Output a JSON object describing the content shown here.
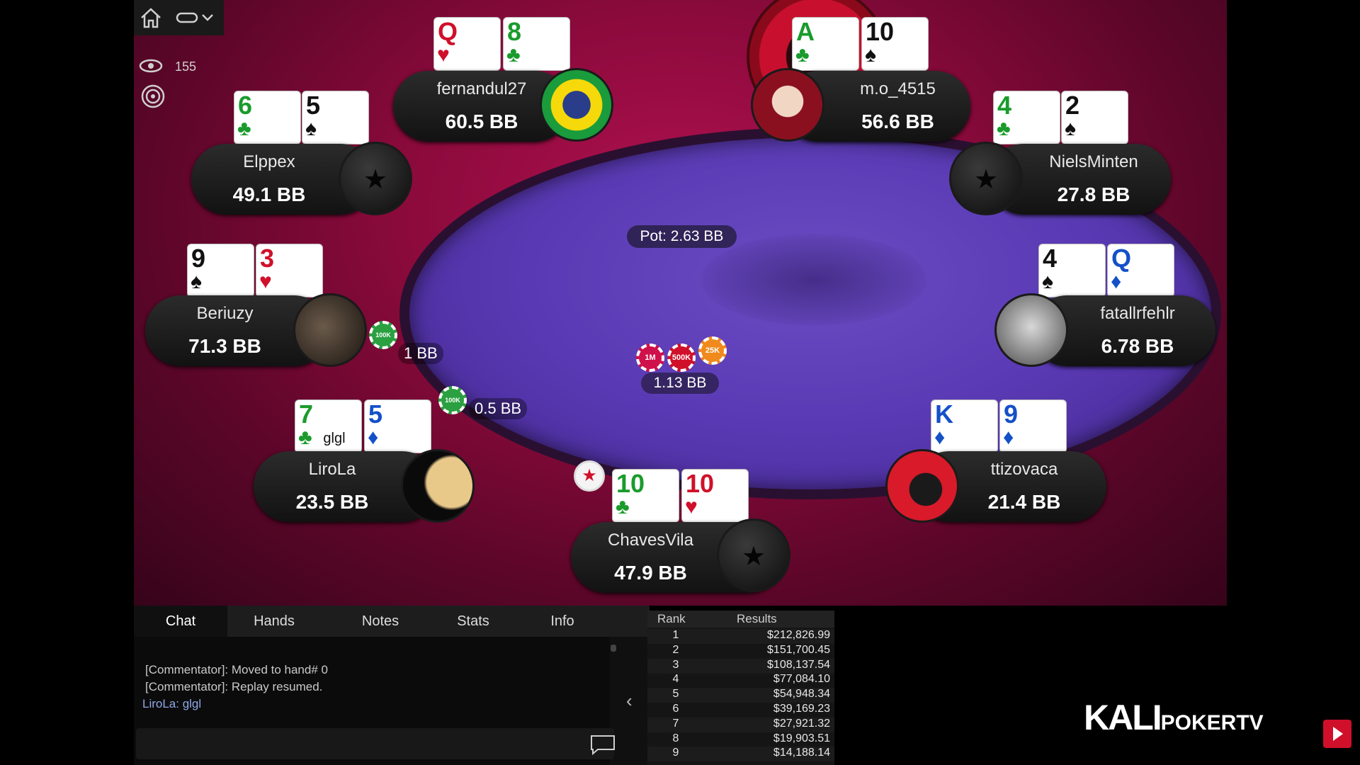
{
  "spectators": {
    "count": "155"
  },
  "pot": {
    "label": "Pot: 2.63 BB"
  },
  "center_bet": {
    "label": "1.13 BB"
  },
  "chip_labels": {
    "c1m": "1M",
    "c500k": "500K",
    "c25k": "25K",
    "c100k": "100K"
  },
  "players": {
    "fernandul27": {
      "name": "fernandul27",
      "stack": "60.5 BB",
      "cards": [
        {
          "rank": "Q",
          "suit": "♥"
        },
        {
          "rank": "8",
          "suit": "♣"
        }
      ]
    },
    "mo4515": {
      "name": "m.o_4515",
      "stack": "56.6 BB",
      "cards": [
        {
          "rank": "A",
          "suit": "♣"
        },
        {
          "rank": "10",
          "suit": "♠"
        }
      ]
    },
    "elppex": {
      "name": "Elppex",
      "stack": "49.1 BB",
      "cards": [
        {
          "rank": "6",
          "suit": "♣"
        },
        {
          "rank": "5",
          "suit": "♠"
        }
      ]
    },
    "nielsminten": {
      "name": "NielsMinten",
      "stack": "27.8 BB",
      "cards": [
        {
          "rank": "4",
          "suit": "♣"
        },
        {
          "rank": "2",
          "suit": "♠"
        }
      ]
    },
    "beriuzy": {
      "name": "Beriuzy",
      "stack": "71.3 BB",
      "bet": "1 BB",
      "cards": [
        {
          "rank": "9",
          "suit": "♠"
        },
        {
          "rank": "3",
          "suit": "♥"
        }
      ]
    },
    "fatallrfehlr": {
      "name": "fatallrfehlr",
      "stack": "6.78 BB",
      "cards": [
        {
          "rank": "4",
          "suit": "♠"
        },
        {
          "rank": "Q",
          "suit": "♦"
        }
      ]
    },
    "lirola": {
      "name": "LiroLa",
      "stack": "23.5 BB",
      "bet": "0.5 BB",
      "bubble": "glgl",
      "cards": [
        {
          "rank": "7",
          "suit": "♣"
        },
        {
          "rank": "5",
          "suit": "♦"
        }
      ]
    },
    "ttizovaca": {
      "name": "ttizovaca",
      "stack": "21.4 BB",
      "cards": [
        {
          "rank": "K",
          "suit": "♦"
        },
        {
          "rank": "9",
          "suit": "♦"
        }
      ]
    },
    "chavesvila": {
      "name": "ChavesVila",
      "stack": "47.9 BB",
      "cards": [
        {
          "rank": "10",
          "suit": "♣"
        },
        {
          "rank": "10",
          "suit": "♥"
        }
      ]
    }
  },
  "tabs": [
    "Chat",
    "Hands",
    "Notes",
    "Stats",
    "Info"
  ],
  "chat": [
    "[Commentator]: Moved to hand# 0",
    "[Commentator]: Replay resumed.",
    "LiroLa: glgl"
  ],
  "results": {
    "headers": {
      "rank": "Rank",
      "results": "Results"
    },
    "rows": [
      {
        "rank": "1",
        "value": "$212,826.99"
      },
      {
        "rank": "2",
        "value": "$151,700.45"
      },
      {
        "rank": "3",
        "value": "$108,137.54"
      },
      {
        "rank": "4",
        "value": "$77,084.10"
      },
      {
        "rank": "5",
        "value": "$54,948.34"
      },
      {
        "rank": "6",
        "value": "$39,169.23"
      },
      {
        "rank": "7",
        "value": "$27,921.32"
      },
      {
        "rank": "8",
        "value": "$19,903.51"
      },
      {
        "rank": "9",
        "value": "$14,188.14"
      }
    ]
  },
  "brand": {
    "main": "KALI",
    "sub": "POKERTV"
  },
  "colors": {
    "felt": "#5a3ab4",
    "table_bg": "#8c0a3c",
    "clubs": "#1a9b2c",
    "hearts": "#d0102a",
    "diamonds": "#1450c8",
    "spades": "#111111"
  },
  "icons": [
    "home-icon",
    "dropdown-icon",
    "eye-icon",
    "target-icon",
    "dealer-button-icon",
    "chat-bubble-icon",
    "collapse-chevron-icon",
    "play-icon"
  ]
}
